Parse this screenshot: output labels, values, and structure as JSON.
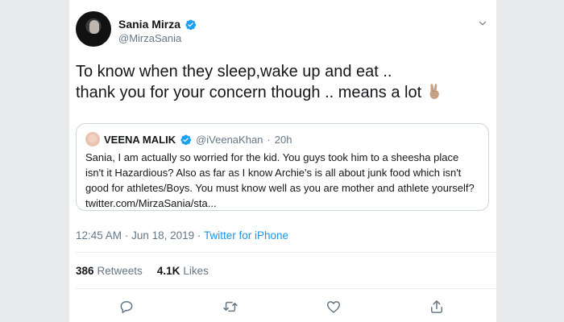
{
  "author": {
    "name": "Sania Mirza",
    "handle": "@MirzaSania"
  },
  "tweet": {
    "line1": "To know when they sleep,wake up and eat ..",
    "line2": "thank you for your concern though .. means a lot"
  },
  "quoted": {
    "name": "VEENA MALIK",
    "handle": "@iVeenaKhan",
    "separator": "·",
    "time": "20h",
    "lines": [
      "Sania, I am actually so worried for the kid. You guys took him to a sheesha place",
      "isn't it Hazardious? Also as far as I know Archie's is all about junk food which isn't",
      "good for athletes/Boys. You must know well as you are mother and athlete yourself?",
      "twitter.com/MirzaSania/sta..."
    ]
  },
  "meta": {
    "time": "12:45 AM",
    "sep1": "·",
    "date": "Jun 18, 2019",
    "sep2": "·",
    "source": "Twitter for iPhone"
  },
  "stats": {
    "retweets_count": "386",
    "retweets_label": "Retweets",
    "likes_count": "4.1K",
    "likes_label": "Likes"
  },
  "colors": {
    "verified": "#1da1f2",
    "link": "#1b95e0",
    "muted": "#657786",
    "icon": "#657786"
  },
  "icons": {
    "verified": "verified-badge-icon",
    "caret": "chevron-down-icon",
    "reply": "reply-icon",
    "retweet": "retweet-icon",
    "like": "heart-icon",
    "share": "share-icon",
    "emoji": "victory-hand-emoji"
  }
}
